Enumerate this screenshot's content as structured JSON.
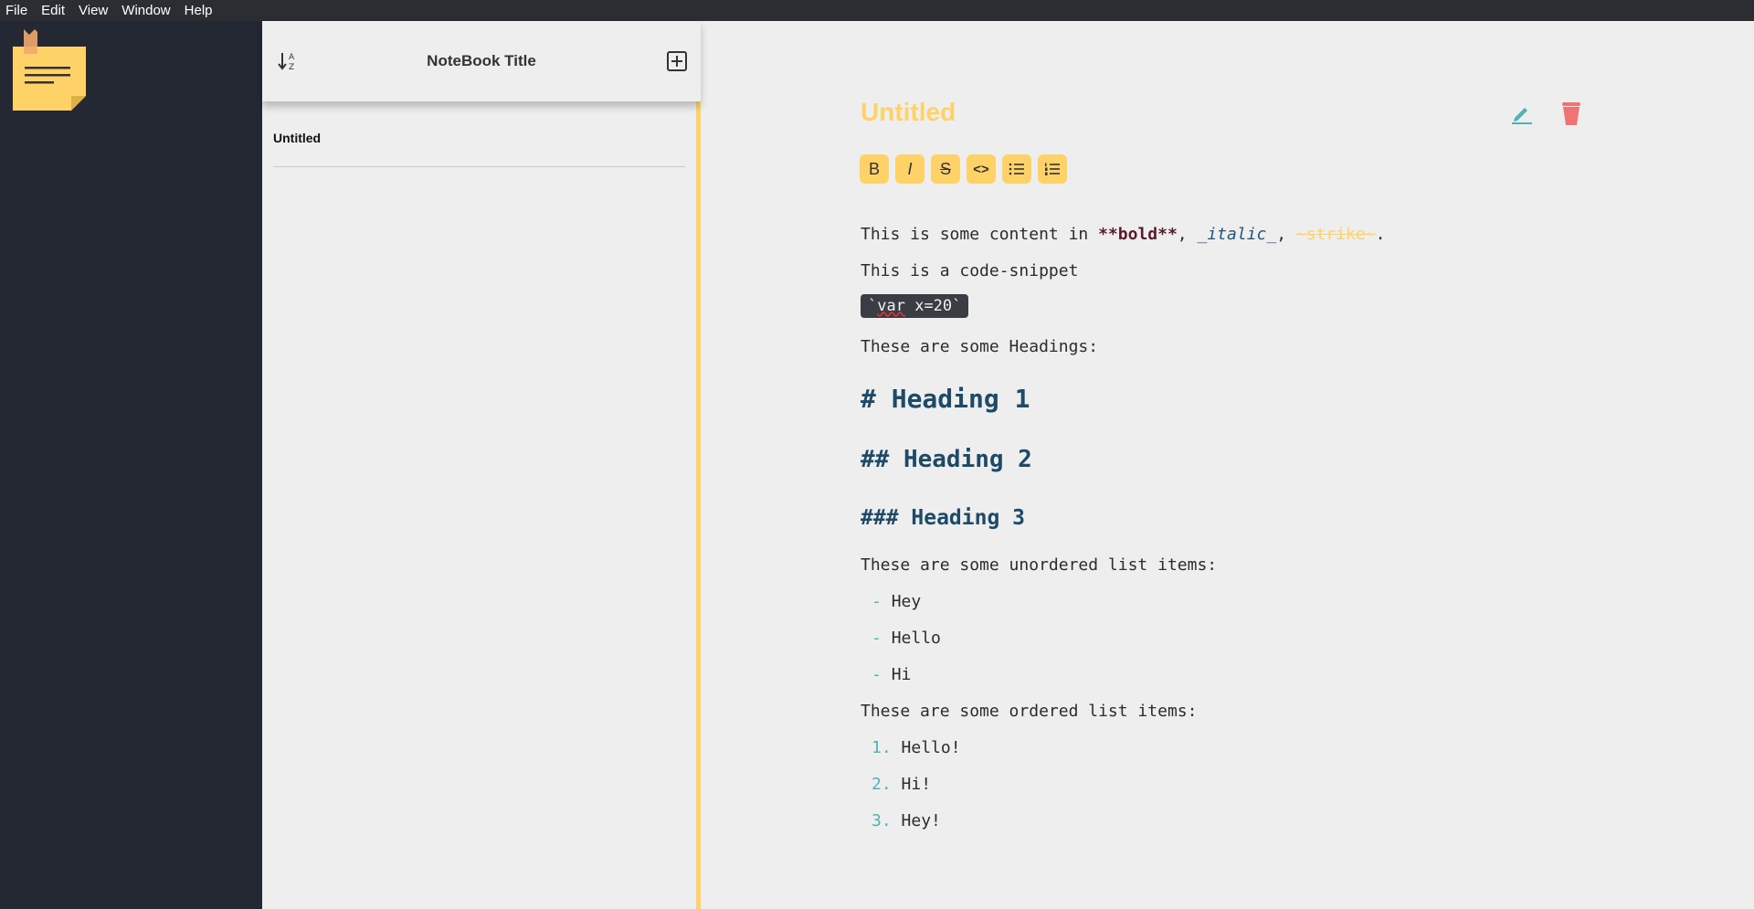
{
  "menu": [
    "File",
    "Edit",
    "View",
    "Window",
    "Help"
  ],
  "notebook": {
    "title": "NoteBook Title"
  },
  "notes": [
    {
      "title": "Untitled"
    }
  ],
  "editor": {
    "title": "Untitled",
    "toolbar": [
      {
        "name": "bold",
        "label": "B"
      },
      {
        "name": "italic",
        "label": "I"
      },
      {
        "name": "strikethrough",
        "label": "S"
      },
      {
        "name": "code",
        "label": "<>"
      },
      {
        "name": "unordered-list",
        "label": ""
      },
      {
        "name": "ordered-list",
        "label": ""
      }
    ],
    "content": {
      "line1_prefix": "This is some content in ",
      "line1_bold": "**bold**",
      "line1_sep1": ", ",
      "line1_italic": "_italic_",
      "line1_sep2": ", ",
      "line1_strike": "~strike~",
      "line1_end": ".",
      "line2": "This is a code-snippet",
      "code_tick_open": "`",
      "code_var": "var",
      "code_rest": " x=20`",
      "line4": "These are some Headings:",
      "heading1": "# Heading 1",
      "heading2": "## Heading 2",
      "heading3": "### Heading 3",
      "ul_intro": "These are some unordered list items:",
      "ul_marker": "-",
      "ul_items": [
        "Hey",
        "Hello",
        "Hi"
      ],
      "ol_intro": "These are some ordered list items:",
      "ol_markers": [
        "1.",
        "2.",
        "3."
      ],
      "ol_items": [
        "Hello!",
        "Hi!",
        "Hey!"
      ]
    }
  },
  "colors": {
    "accent": "#ffd267",
    "sidebar": "#232833",
    "teal": "#4fb3b3",
    "delete": "#f07474"
  }
}
